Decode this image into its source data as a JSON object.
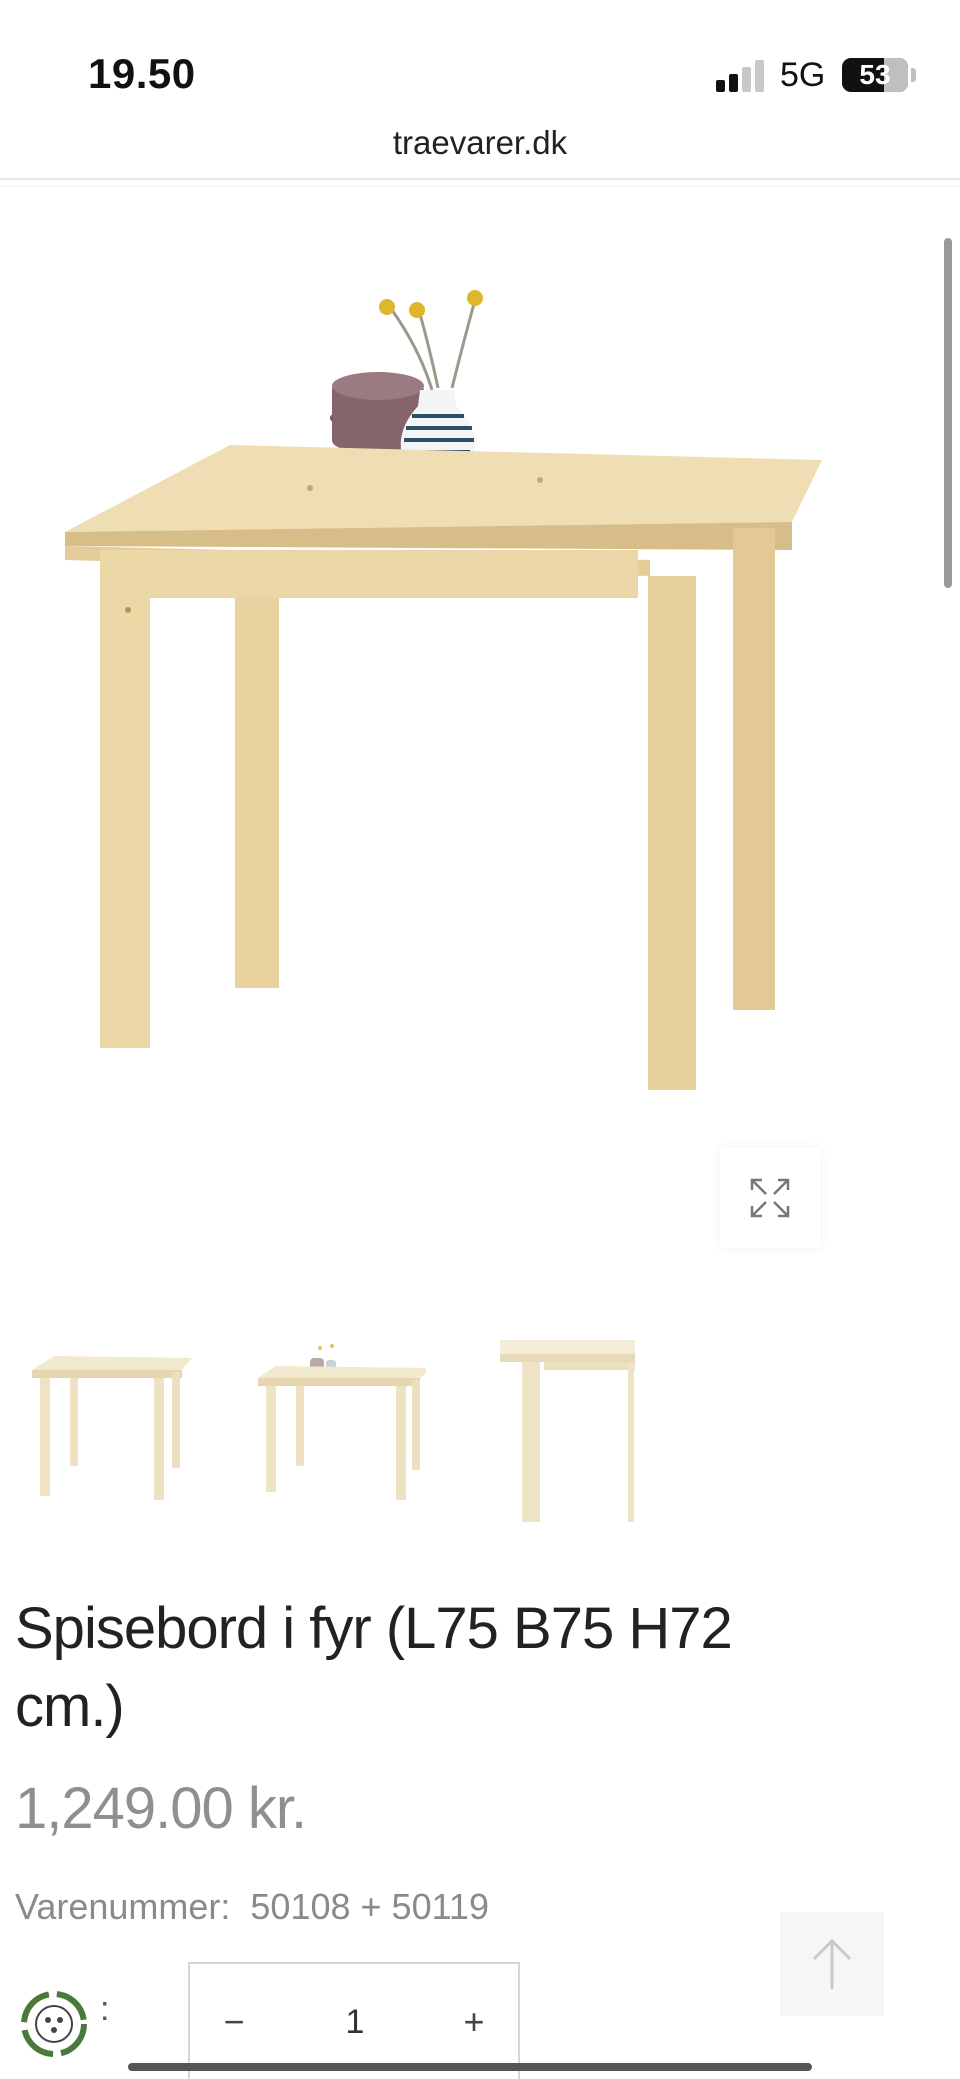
{
  "status_bar": {
    "time": "19.50",
    "network": "5G",
    "battery": "53"
  },
  "browser": {
    "url": "traevarer.dk"
  },
  "product": {
    "title": "Spisebord i fyr (L75 B75 H72 cm.)",
    "price": "1,249.00  kr.",
    "sku_label": "Varenummer:",
    "sku_value": "50108 + 50119",
    "quantity_label": ":",
    "quantity": "1",
    "minus_symbol": "−",
    "plus_symbol": "+"
  },
  "icons": {
    "zoom": "expand-icon",
    "scroll_top": "arrow-up-icon",
    "eco": "recycle-icon"
  },
  "colors": {
    "wood": "#eedcb1",
    "price_text": "#8f8f8f"
  }
}
